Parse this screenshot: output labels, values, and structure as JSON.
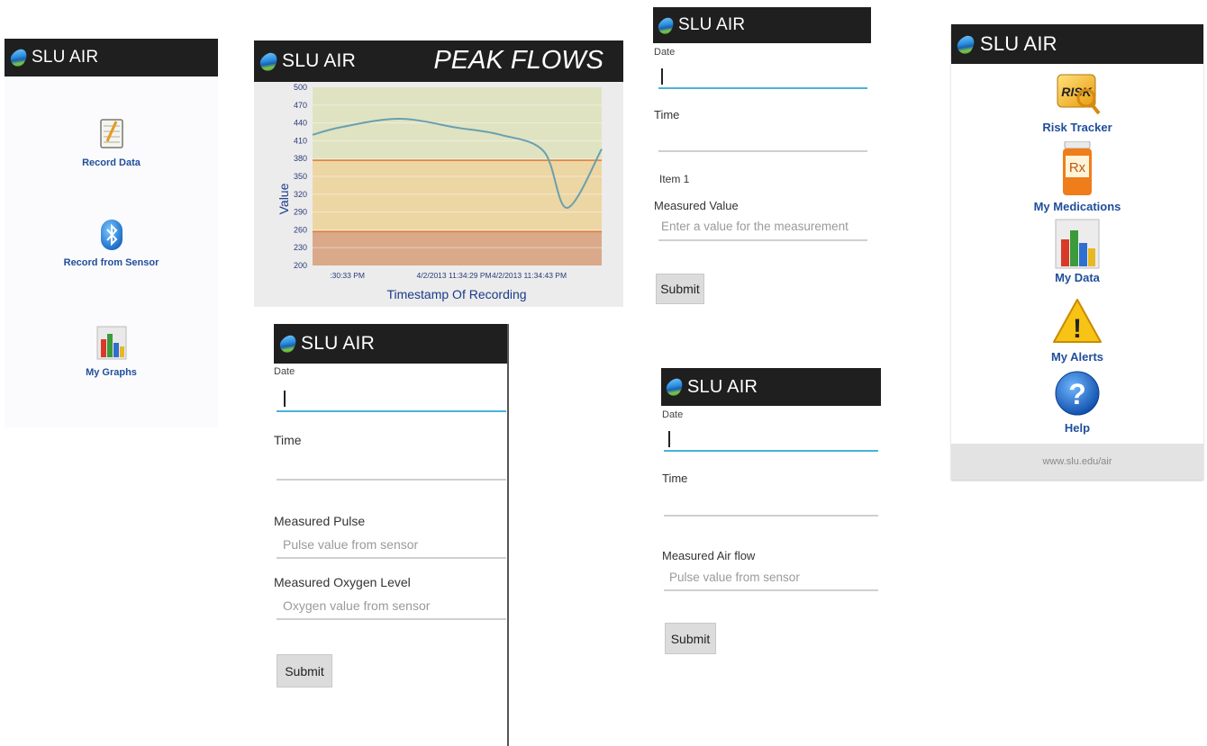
{
  "app_name": "SLU AIR",
  "main_menu": {
    "items": [
      {
        "label": "Record Data",
        "icon": "notepad-icon"
      },
      {
        "label": "Record from Sensor",
        "icon": "bluetooth-icon"
      },
      {
        "label": "My Graphs",
        "icon": "bar-chart-icon"
      }
    ]
  },
  "peak_flows": {
    "title": "PEAK FLOWS",
    "chart_data": {
      "type": "line",
      "title": "PEAK FLOWS",
      "xlabel": "Timestamp Of Recording",
      "ylabel": "Value",
      "ylim": [
        200,
        500
      ],
      "ytick_labels": [
        "200",
        "230",
        "260",
        "290",
        "320",
        "350",
        "380",
        "410",
        "440",
        "470",
        "500"
      ],
      "xtick_labels": [
        ":30:33 PM",
        "4/2/2013 11:34:29 PM",
        "4/2/2013 11:34:43 PM"
      ],
      "series": [
        {
          "x": [
            0,
            0.1,
            0.3,
            0.5,
            0.65,
            0.8,
            0.88,
            1.0
          ],
          "y": [
            420,
            433,
            447,
            432,
            420,
            392,
            297,
            396
          ]
        }
      ],
      "grid": true,
      "bands": [
        {
          "from": 200,
          "to": 257,
          "color": "#d9a98a"
        },
        {
          "from": 257,
          "to": 377,
          "color": "#ecd6a4"
        },
        {
          "from": 377,
          "to": 500,
          "color": "#dfe3c2"
        }
      ]
    }
  },
  "item_form": {
    "date_label": "Date",
    "time_label": "Time",
    "item_label": "Item 1",
    "measured_label": "Measured Value",
    "measured_placeholder": "Enter a value for the measurement",
    "submit_label": "Submit"
  },
  "home_menu": {
    "items": [
      {
        "label": "Risk Tracker",
        "icon": "risk-icon",
        "badge": "RISK"
      },
      {
        "label": "My Medications",
        "icon": "pill-bottle-icon",
        "badge": "Rx"
      },
      {
        "label": "My Data",
        "icon": "bar-chart-icon"
      },
      {
        "label": "My Alerts",
        "icon": "warning-icon",
        "badge": "!"
      },
      {
        "label": "Help",
        "icon": "help-icon",
        "badge": "?"
      }
    ],
    "footer_url": "www.slu.edu/air"
  },
  "sensor_form": {
    "date_label": "Date",
    "time_label": "Time",
    "pulse_label": "Measured Pulse",
    "pulse_placeholder": "Pulse value from sensor",
    "oxygen_label": "Measured Oxygen Level",
    "oxygen_placeholder": "Oxygen value from sensor",
    "submit_label": "Submit"
  },
  "airflow_form": {
    "date_label": "Date",
    "time_label": "Time",
    "airflow_label": "Measured Air flow",
    "airflow_placeholder": "Pulse value from sensor",
    "submit_label": "Submit"
  }
}
